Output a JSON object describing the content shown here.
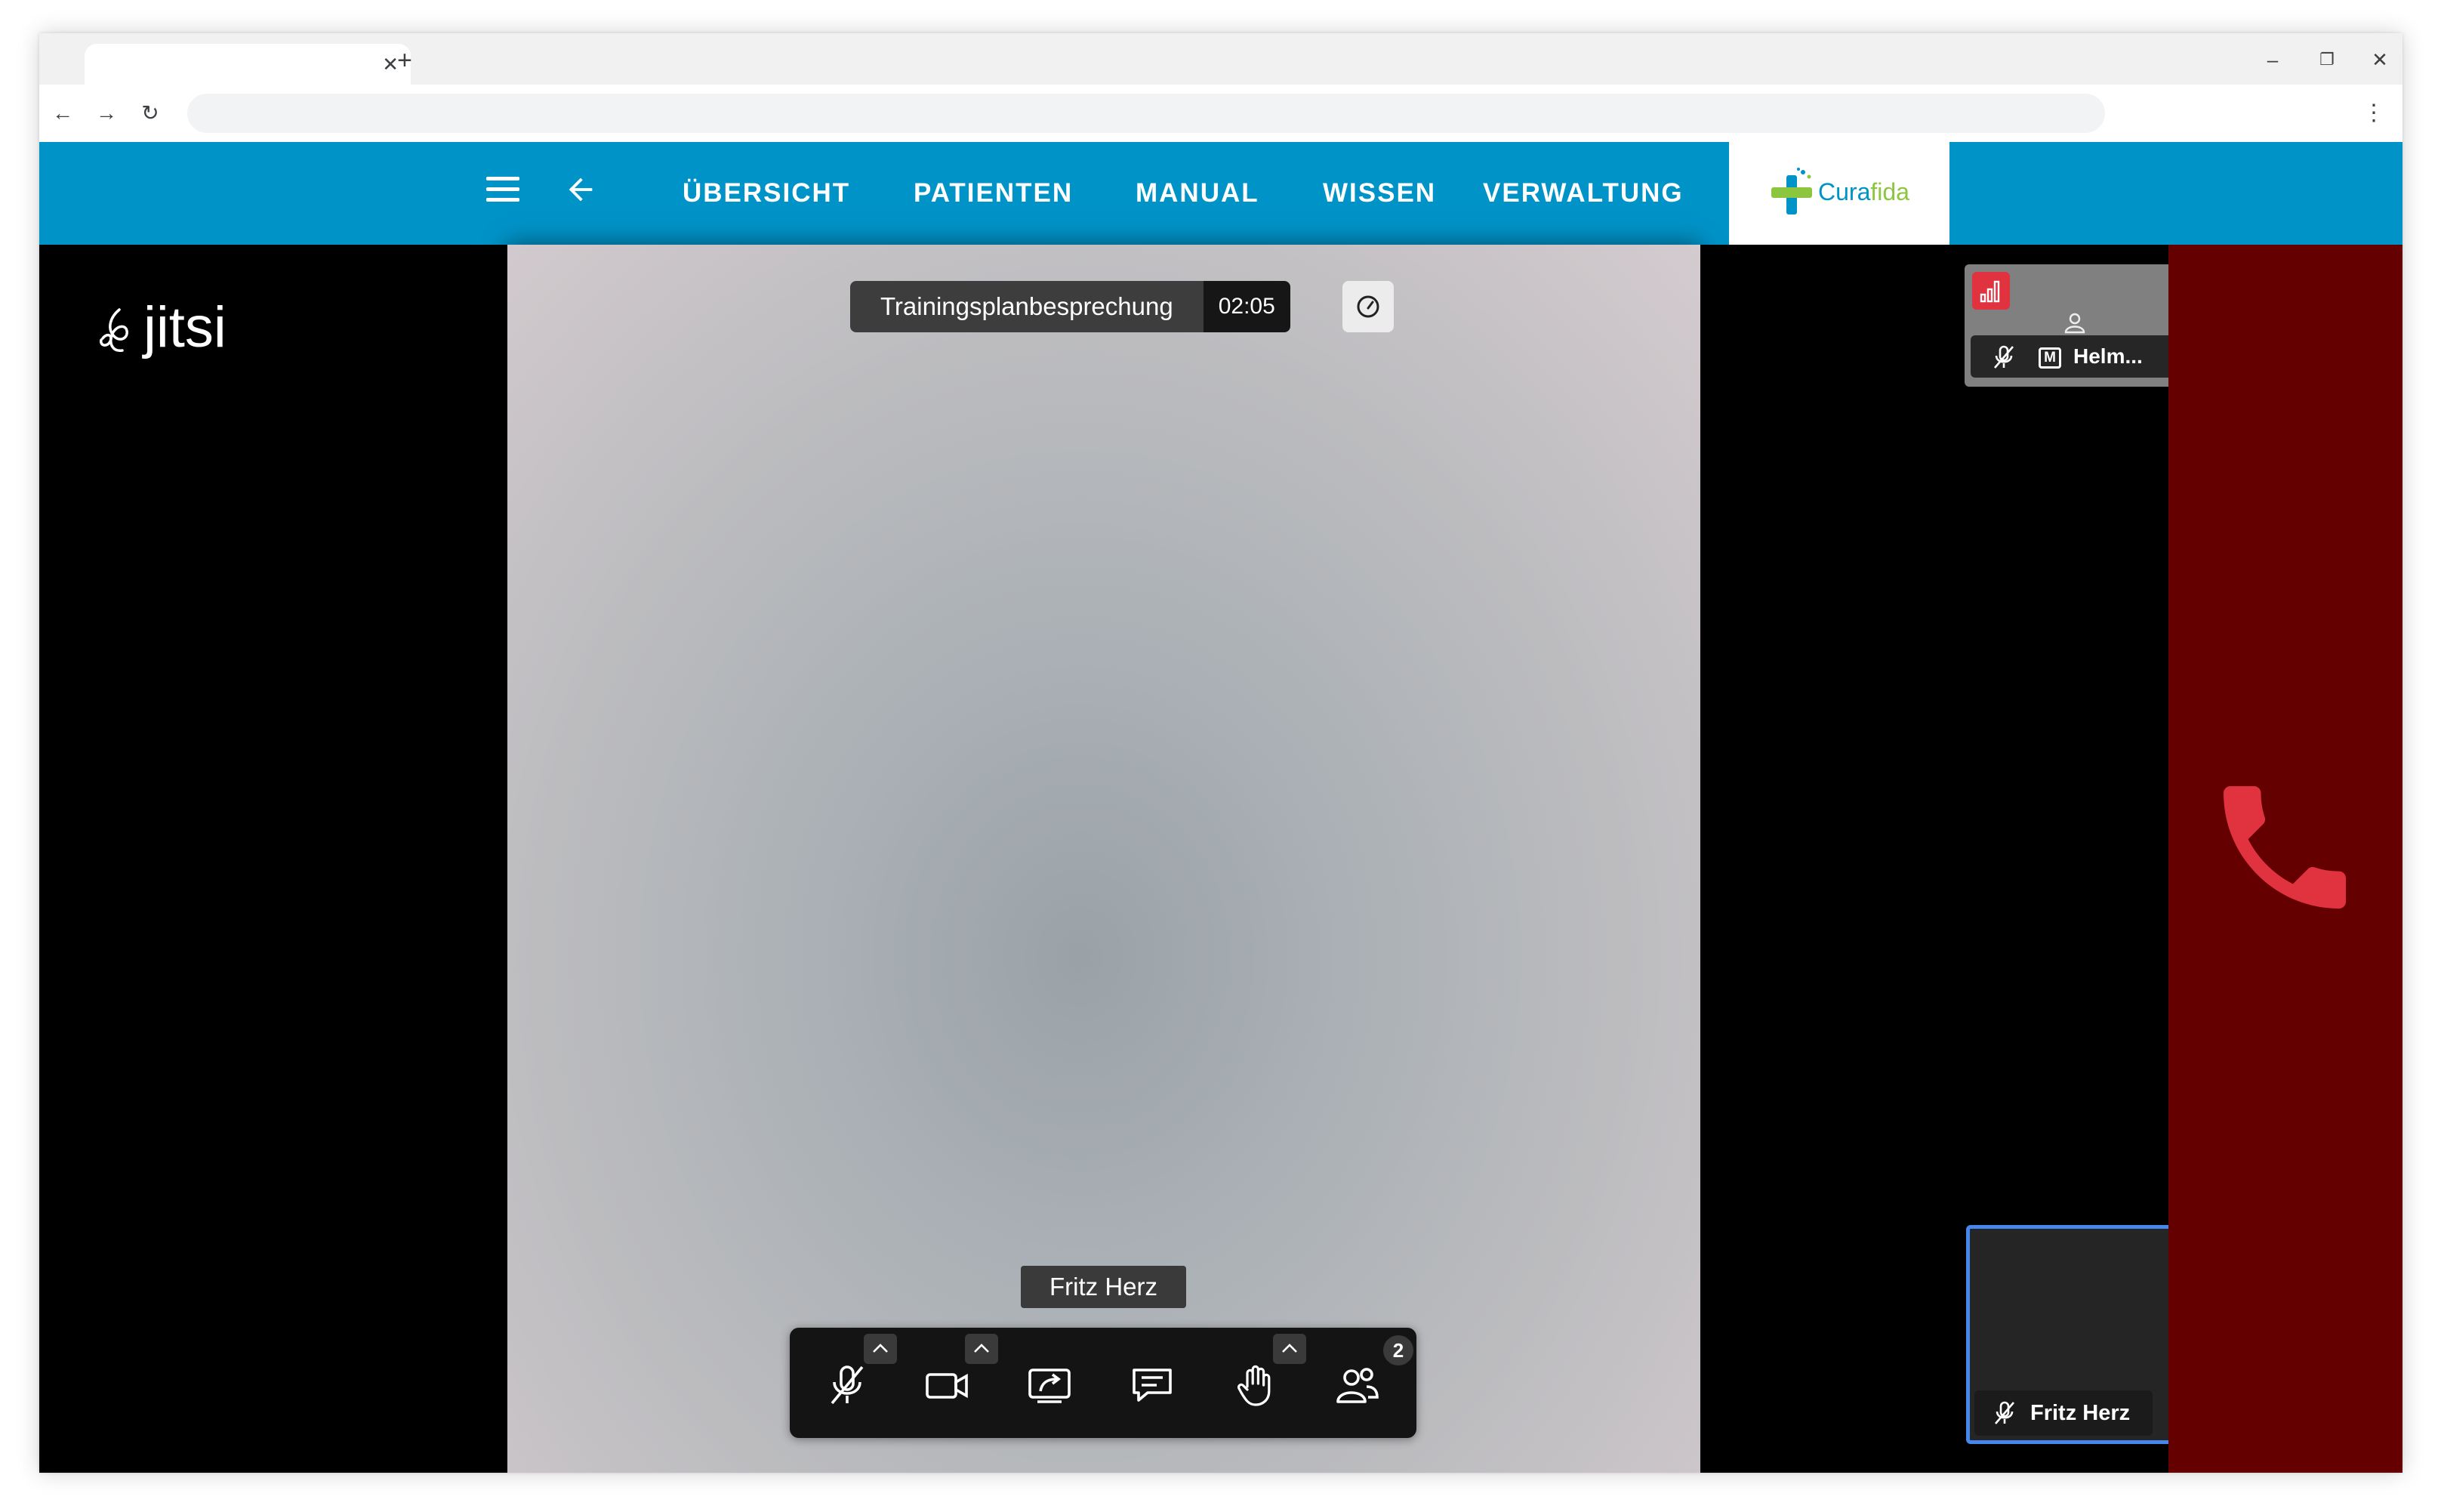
{
  "browser": {
    "tab_title": "",
    "tab_close_icon": "close-icon",
    "new_tab_label": "+",
    "window_controls": {
      "minimize": "–",
      "restore": "❐",
      "close": "✕"
    },
    "nav": {
      "back": "←",
      "forward": "→",
      "reload": "↻"
    },
    "address": "",
    "menu": "⋮"
  },
  "app": {
    "nav_links": [
      "ÜBERSICHT",
      "PATIENTEN",
      "MANUAL",
      "WISSEN",
      "VERWALTUNG"
    ],
    "logo": {
      "part1": "Cura",
      "part2": "fida"
    },
    "accent_color": "#0093c8"
  },
  "meeting": {
    "jitsi_logo": "jitsi",
    "subject": "Trainingsplanbesprechung",
    "timer": "02:05",
    "remote_participant": "Helm...",
    "moderator_badge": "M",
    "local_participant": "Fritz Herz",
    "dominant_speaker_name": "Fritz Herz",
    "participant_count": "2",
    "hangup_color": "#e0323f"
  }
}
